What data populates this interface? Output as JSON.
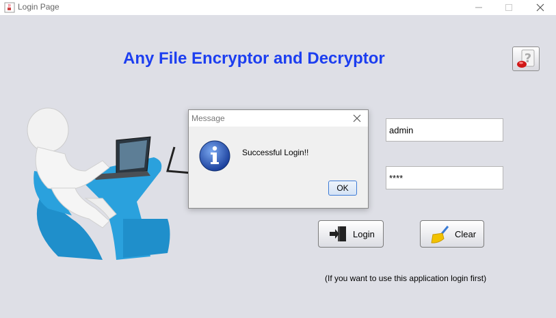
{
  "window": {
    "title": "Login Page",
    "app_icon": "java-coffee-cup-icon"
  },
  "heading": "Any File Encryptor and Decryptor",
  "help_button": {
    "icon": "help-question-icon"
  },
  "form": {
    "username_value": "admin",
    "password_value": "****"
  },
  "buttons": {
    "login_label": "Login",
    "clear_label": "Clear"
  },
  "note": "(If you want to use this application login first)",
  "dialog": {
    "title": "Message",
    "message": "Successful Login!!",
    "ok_label": "OK",
    "icon": "info-icon"
  },
  "colors": {
    "heading": "#1c3ef0",
    "background": "#dedfe6",
    "chair": "#2aa1dd"
  }
}
